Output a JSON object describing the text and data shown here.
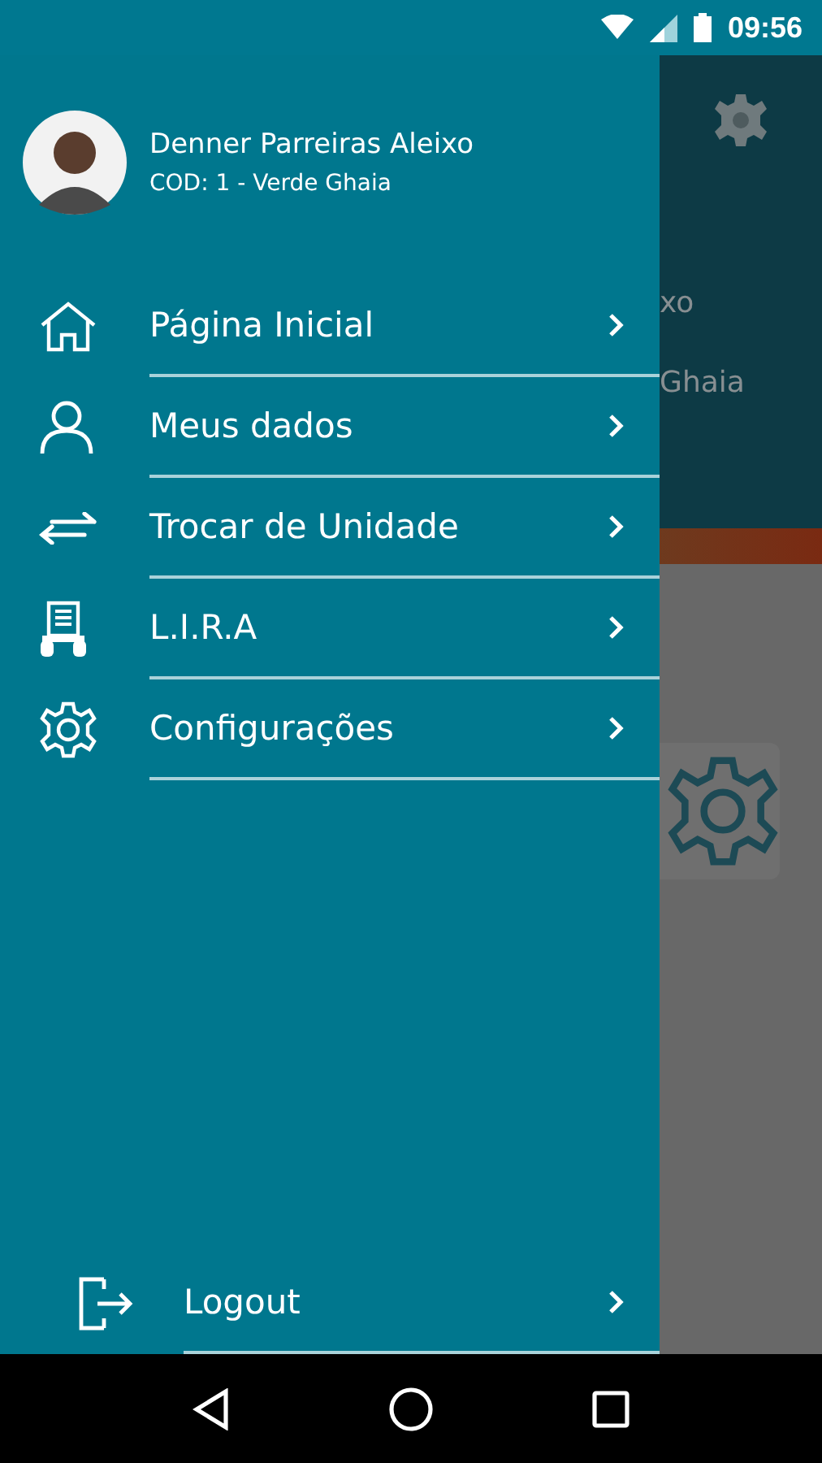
{
  "status_bar": {
    "time": "09:56"
  },
  "drawer": {
    "user": {
      "name": "Denner Parreiras Aleixo",
      "code": "COD: 1 - Verde Ghaia"
    },
    "menu": [
      {
        "label": "Página Inicial"
      },
      {
        "label": "Meus dados"
      },
      {
        "label": "Trocar de Unidade"
      },
      {
        "label": "L.I.R.A"
      },
      {
        "label": "Configurações"
      }
    ],
    "logout": {
      "label": "Logout"
    }
  },
  "background_screen": {
    "header_text_fragments": [
      "xo",
      "Ghaia"
    ]
  }
}
